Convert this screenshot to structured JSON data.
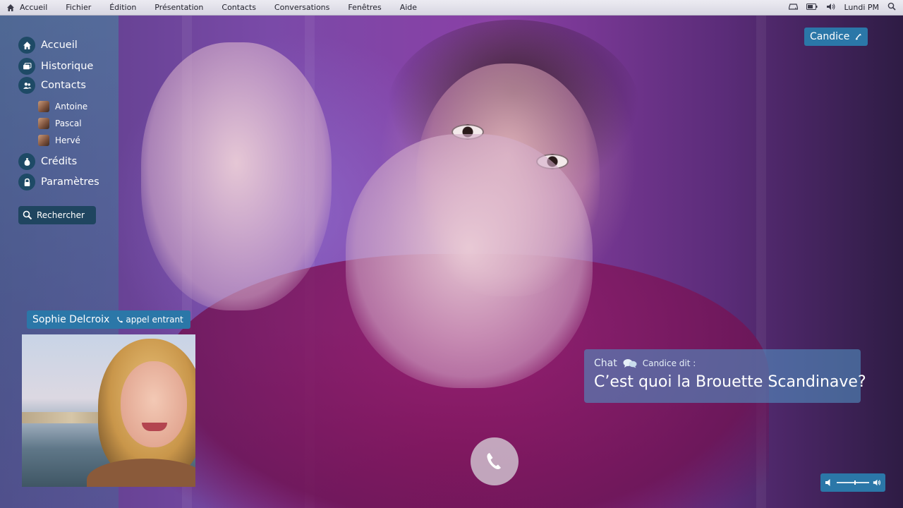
{
  "menubar": {
    "items": [
      "Accueil",
      "Fichier",
      "Édition",
      "Présentation",
      "Contacts",
      "Conversations",
      "Fenêtres",
      "Aide"
    ],
    "clock": "Lundi PM"
  },
  "sidebar": {
    "nav": {
      "accueil": "Accueil",
      "historique": "Historique",
      "contacts": "Contacts",
      "credits": "Crédits",
      "parametres": "Paramètres"
    },
    "contacts": [
      "Antoine",
      "Pascal",
      "Hervé"
    ],
    "search_label": "Rechercher"
  },
  "call": {
    "current_contact": "Candice",
    "incoming_name": "Sophie Delcroix",
    "incoming_status": "appel entrant"
  },
  "chat": {
    "label": "Chat",
    "sender_line": "Candice dit :",
    "message": "C’est quoi la Brouette Scandinave?"
  },
  "volume": {
    "level": 0.55
  },
  "colors": {
    "accent": "#2b77a8",
    "sidebar_icon_bg": "#1e4a66",
    "menubar_bg": "#e4e3ec"
  },
  "icons": {
    "menubar_left": "home-icon",
    "menubar_right": [
      "drive-icon",
      "battery-icon",
      "speaker-icon",
      "search-icon"
    ],
    "nav": [
      "home-icon",
      "history-icon",
      "contacts-icon",
      "credits-icon",
      "lock-icon"
    ],
    "call": "phone-icon",
    "chat": "chat-bubbles-icon",
    "volume": [
      "volume-low-icon",
      "volume-high-icon"
    ]
  }
}
